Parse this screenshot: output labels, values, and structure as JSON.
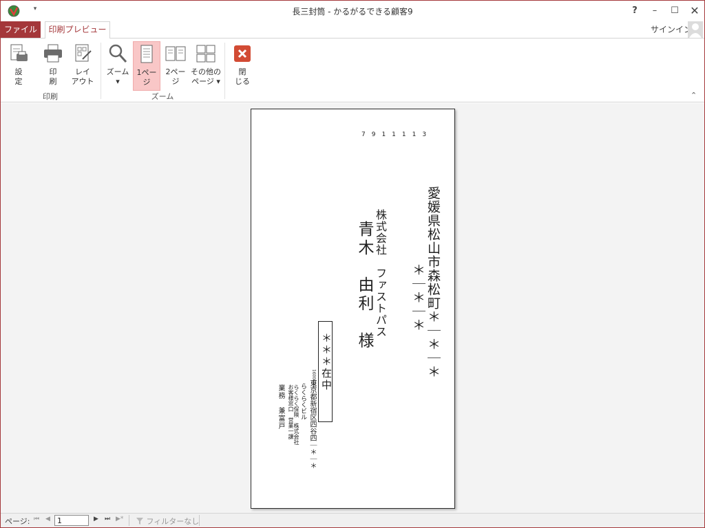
{
  "window": {
    "title": "長三封筒 - かるがるできる顧客9",
    "help": "?",
    "minimize": "–",
    "maximize": "☐",
    "close": "✕",
    "accent_color": "#a4373a"
  },
  "qat": {
    "dropdown": "▾"
  },
  "tabs": {
    "file": "ファイル",
    "print_preview": "印刷プレビュー",
    "signin": "サインイン"
  },
  "ribbon": {
    "print_group": {
      "label": "印刷",
      "settings": "設\n定",
      "print": "印\n刷",
      "layout": "レイ\nアウト"
    },
    "zoom_group": {
      "label": "ズーム",
      "zoom": "ズーム\n▾",
      "one_page": "1ペー\nジ",
      "two_page": "2ペー\nジ",
      "more_pages": "その他の\nページ ▾"
    },
    "close_preview": "閉\nじる",
    "collapse": "⌃"
  },
  "envelope": {
    "postal_code": "7911113",
    "address_line1": "愛媛県松山市森松町＊｜＊｜＊",
    "address_line2": "＊｜＊｜＊",
    "company": "株式会社　ファストパス",
    "recipient": "青木　由利　様",
    "stamp": "＊＊＊在中",
    "sender_zip": "1600004",
    "sender_address": "東京都新宿区四谷四｜＊｜＊",
    "sender_address2": "らくらくビル",
    "sender_company": "らくらく保険　株式会社",
    "sender_dept": "お客様窓口　営業一課",
    "sender_role": "業務　兼富戸"
  },
  "statusbar": {
    "page_label": "ページ:",
    "first": "⏮",
    "prev": "◀",
    "page_value": "1",
    "next": "▶",
    "last": "⏭",
    "new": "▶*",
    "filter": "フィルターなし"
  }
}
